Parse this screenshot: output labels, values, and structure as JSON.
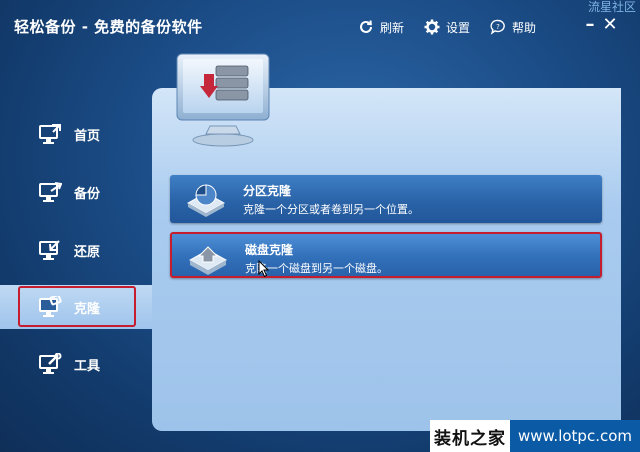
{
  "window": {
    "title": "轻松备份 - 免费的备份软件",
    "corner_watermark": "流星社区",
    "toolbar": {
      "refresh_label": "刷新",
      "settings_label": "设置",
      "help_label": "帮助"
    },
    "controls": {
      "minimize": "–",
      "close": "✕"
    }
  },
  "sidebar": {
    "items": [
      {
        "label": "首页",
        "icon": "home-icon"
      },
      {
        "label": "备份",
        "icon": "backup-icon"
      },
      {
        "label": "还原",
        "icon": "restore-icon"
      },
      {
        "label": "克隆",
        "icon": "clone-icon",
        "active": true
      },
      {
        "label": "工具",
        "icon": "tools-icon"
      }
    ]
  },
  "main": {
    "options": [
      {
        "title": "分区克隆",
        "description": "克隆一个分区或者卷到另一个位置。",
        "icon": "partition-clone-icon"
      },
      {
        "title": "磁盘克隆",
        "description": "克隆一个磁盘到另一个磁盘。",
        "icon": "disk-clone-icon",
        "selected": true
      }
    ]
  },
  "watermark": {
    "left": "装机之家",
    "right": "www.lotpc.com"
  },
  "colors": {
    "highlight_border": "#c51d2d",
    "panel": "#a9cbef",
    "option": "#2a63a8",
    "window": "#1b4c86"
  }
}
